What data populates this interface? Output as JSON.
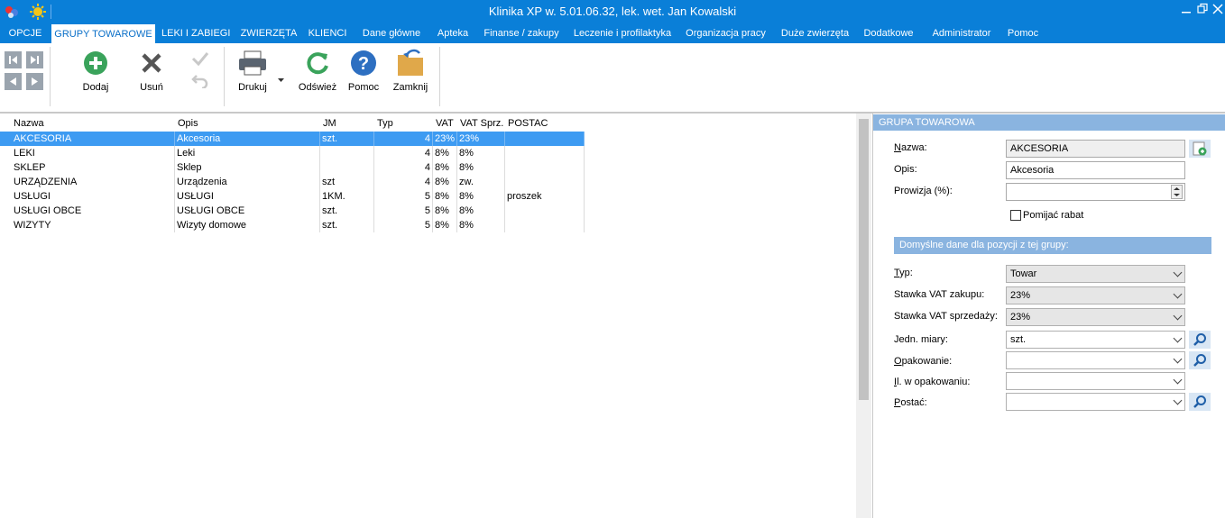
{
  "window": {
    "title": "Klinika XP w. 5.01.06.32, lek. wet. Jan Kowalski"
  },
  "menu": [
    "OPCJE",
    "GRUPY TOWAROWE",
    "LEKI I ZABIEGI",
    "ZWIERZĘTA",
    "KLIENCI",
    "Dane główne",
    "Apteka",
    "Finanse / zakupy",
    "Leczenie i profilaktyka",
    "Organizacja pracy",
    "Duże zwierzęta",
    "Dodatkowe",
    "Administrator",
    "Pomoc"
  ],
  "toolbar": {
    "add": "Dodaj",
    "delete": "Usuń",
    "print": "Drukuj",
    "refresh": "Odśwież",
    "help": "Pomoc",
    "close": "Zamknij"
  },
  "grid": {
    "columns": [
      "Nazwa",
      "Opis",
      "JM",
      "Typ",
      "VAT z",
      "VAT Sprz.",
      "POSTAC"
    ],
    "rows": [
      [
        "AKCESORIA",
        "Akcesoria",
        "szt.",
        "4",
        "23%",
        "23%",
        ""
      ],
      [
        "LEKI",
        "Leki",
        "",
        "4",
        "8%",
        "8%",
        ""
      ],
      [
        "SKLEP",
        "Sklep",
        "",
        "4",
        "8%",
        "8%",
        ""
      ],
      [
        "URZĄDZENIA",
        "Urządzenia",
        "szt",
        "4",
        "8%",
        "zw.",
        ""
      ],
      [
        "USŁUGI",
        "USŁUGI",
        "1KM.",
        "5",
        "8%",
        "8%",
        "proszek"
      ],
      [
        "USŁUGI OBCE",
        "USŁUGI OBCE",
        "szt.",
        "5",
        "8%",
        "8%",
        ""
      ],
      [
        "WIZYTY",
        "Wizyty domowe",
        "szt.",
        "5",
        "8%",
        "8%",
        ""
      ]
    ]
  },
  "panel": {
    "title": "GRUPA TOWAROWA",
    "name_label": "Nazwa:",
    "name_value": "AKCESORIA",
    "desc_label": "Opis:",
    "desc_value": "Akcesoria",
    "commission_label": "Prowizja (%):",
    "commission_value": "",
    "skip_discount_label": "Pomijać rabat",
    "defaults_header": "Domyślne dane dla pozycji z tej grupy:",
    "type_label": "Typ:",
    "type_value": "Towar",
    "vat_purchase_label": "Stawka VAT zakupu:",
    "vat_purchase_value": "23%",
    "vat_sale_label": "Stawka VAT sprzedaży:",
    "vat_sale_value": "23%",
    "unit_label": "Jedn. miary:",
    "unit_value": "szt.",
    "packaging_label": "Opakowanie:",
    "packaging_value": "",
    "qty_label": "Il. w opakowaniu:",
    "qty_value": "",
    "form_label": "Postać:",
    "form_value": ""
  },
  "colors": {
    "accent": "#0a7fd8",
    "selection": "#3d9bf2",
    "panel_header": "#8ab4e0"
  }
}
